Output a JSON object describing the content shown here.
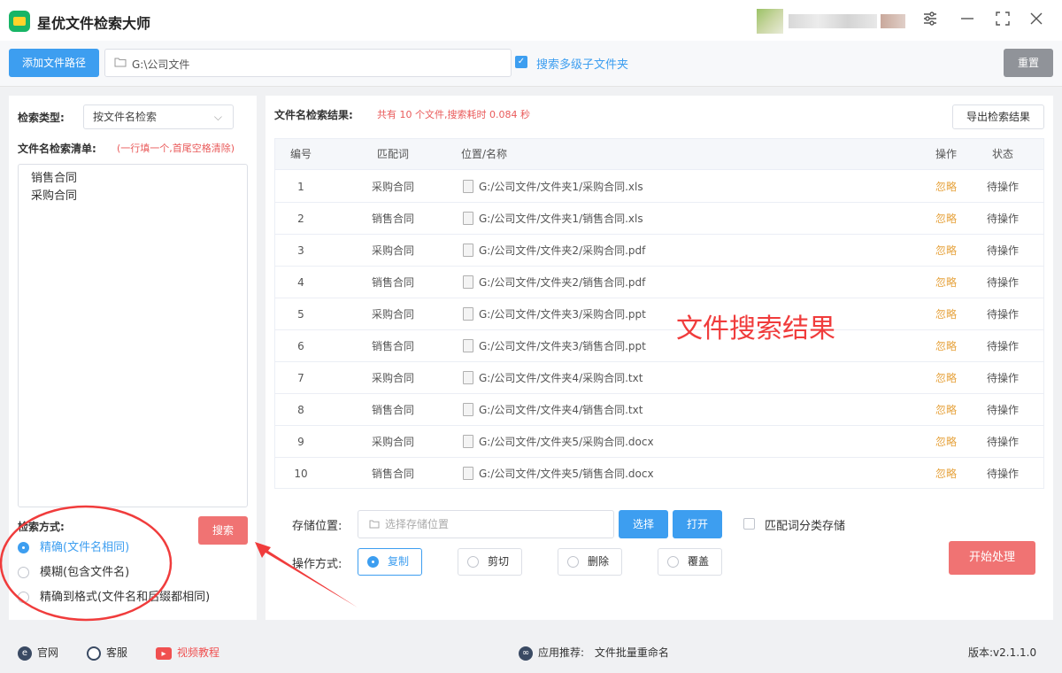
{
  "app": {
    "title": "星优文件检索大师"
  },
  "window_controls": [
    "settings-icon",
    "minimize-icon",
    "maximize-icon",
    "close-icon"
  ],
  "topbar": {
    "add_path_label": "添加文件路径",
    "path_value": "G:\\公司文件",
    "subfolder_checked": true,
    "subfolder_label": "搜索多级子文件夹",
    "reset_label": "重置"
  },
  "left_panel": {
    "search_type_label": "检索类型:",
    "search_type_value": "按文件名检索",
    "list_label": "文件名检索清单:",
    "list_hint": "(一行填一个,首尾空格清除)",
    "list_items": [
      "销售合同",
      "采购合同"
    ],
    "method_label": "检索方式:",
    "search_button": "搜索",
    "methods": [
      {
        "label": "精确(文件名相同)",
        "selected": true
      },
      {
        "label": "模糊(包含文件名)",
        "selected": false
      },
      {
        "label": "精确到格式(文件名和后缀都相同)",
        "selected": false
      }
    ]
  },
  "results": {
    "title": "文件名检索结果:",
    "summary": "共有 10 个文件,搜索耗时 0.084 秒",
    "export_label": "导出检索结果",
    "columns": [
      "编号",
      "匹配词",
      "位置/名称",
      "操作",
      "状态"
    ],
    "rows": [
      {
        "num": "1",
        "keyword": "采购合同",
        "path": "G:/公司文件/文件夹1/采购合同.xls",
        "action": "忽略",
        "status": "待操作"
      },
      {
        "num": "2",
        "keyword": "销售合同",
        "path": "G:/公司文件/文件夹1/销售合同.xls",
        "action": "忽略",
        "status": "待操作"
      },
      {
        "num": "3",
        "keyword": "采购合同",
        "path": "G:/公司文件/文件夹2/采购合同.pdf",
        "action": "忽略",
        "status": "待操作"
      },
      {
        "num": "4",
        "keyword": "销售合同",
        "path": "G:/公司文件/文件夹2/销售合同.pdf",
        "action": "忽略",
        "status": "待操作"
      },
      {
        "num": "5",
        "keyword": "采购合同",
        "path": "G:/公司文件/文件夹3/采购合同.ppt",
        "action": "忽略",
        "status": "待操作"
      },
      {
        "num": "6",
        "keyword": "销售合同",
        "path": "G:/公司文件/文件夹3/销售合同.ppt",
        "action": "忽略",
        "status": "待操作"
      },
      {
        "num": "7",
        "keyword": "采购合同",
        "path": "G:/公司文件/文件夹4/采购合同.txt",
        "action": "忽略",
        "status": "待操作"
      },
      {
        "num": "8",
        "keyword": "销售合同",
        "path": "G:/公司文件/文件夹4/销售合同.txt",
        "action": "忽略",
        "status": "待操作"
      },
      {
        "num": "9",
        "keyword": "采购合同",
        "path": "G:/公司文件/文件夹5/采购合同.docx",
        "action": "忽略",
        "status": "待操作"
      },
      {
        "num": "10",
        "keyword": "销售合同",
        "path": "G:/公司文件/文件夹5/销售合同.docx",
        "action": "忽略",
        "status": "待操作"
      }
    ],
    "annotation": "文件搜索结果"
  },
  "bottom": {
    "store_label": "存储位置:",
    "store_placeholder": "选择存储位置",
    "select_label": "选择",
    "open_label": "打开",
    "classify_label": "匹配词分类存储",
    "op_label": "操作方式:",
    "ops": [
      {
        "label": "复制",
        "selected": true
      },
      {
        "label": "剪切",
        "selected": false
      },
      {
        "label": "删除",
        "selected": false
      },
      {
        "label": "覆盖",
        "selected": false
      }
    ],
    "start_label": "开始处理"
  },
  "statusbar": {
    "website": "官网",
    "service": "客服",
    "video": "视频教程",
    "recommend_label": "应用推荐:",
    "recommend_app": "文件批量重命名",
    "version": "版本:v2.1.1.0"
  },
  "colors": {
    "primary": "#3d9ef0",
    "danger": "#f07373",
    "warning": "#e6a23c",
    "annotation": "#f03c3c"
  }
}
